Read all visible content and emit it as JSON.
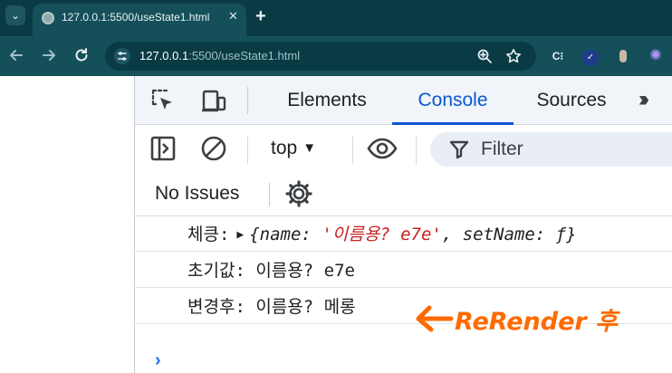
{
  "browser": {
    "tab_title": "127.0.0.1:5500/useState1.html",
    "tab_close_glyph": "✕",
    "new_tab_glyph": "+",
    "tab_menu_glyph": "⌄",
    "url_host": "127.0.0.1",
    "url_rest": ":5500/useState1.html",
    "icons": {
      "back": "arrow-left-icon",
      "forward": "arrow-right-icon",
      "reload": "reload-icon",
      "zoom": "zoom-icon",
      "bookmark": "star-icon"
    },
    "colors": {
      "frame": "#0a3b44",
      "toolbar": "#15505a"
    }
  },
  "devtools": {
    "tabs": [
      "Elements",
      "Console",
      "Sources"
    ],
    "active_tab": "Console",
    "context": "top",
    "filter_placeholder": "Filter",
    "issues": "No Issues",
    "accent": "#0b57d0"
  },
  "console": {
    "logs": [
      {
        "label": "체킁:",
        "object_open": "{name: ",
        "object_name_value": "'이름용? e7e'",
        "object_rest": ", setName: ƒ}"
      },
      {
        "text": "초기값: 이름용? e7e"
      },
      {
        "text": "변경후: 이름용? 메롱"
      }
    ]
  },
  "annotation": {
    "text": "ReRender 후",
    "color": "#ff6a00"
  }
}
